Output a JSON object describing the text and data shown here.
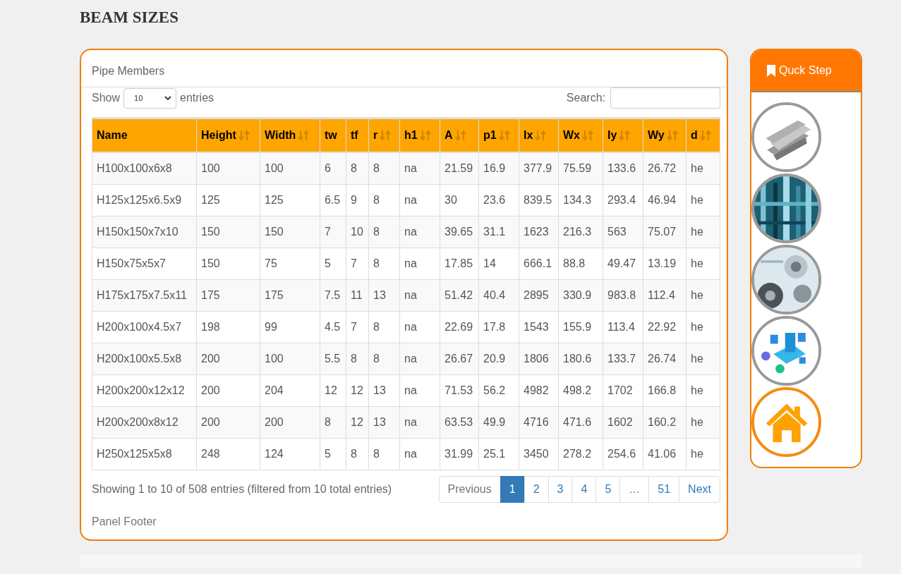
{
  "page_title": "BEAM SIZES",
  "panel": {
    "heading": "Pipe Members",
    "show_label": "Show",
    "page_size": "10",
    "entries_label": "entries",
    "search_label": "Search:",
    "table": {
      "columns": [
        {
          "label": "Name",
          "sortable": false
        },
        {
          "label": "Height",
          "sortable": true
        },
        {
          "label": "Width",
          "sortable": true
        },
        {
          "label": "tw",
          "sortable": false
        },
        {
          "label": "tf",
          "sortable": false
        },
        {
          "label": "r",
          "sortable": true
        },
        {
          "label": "h1",
          "sortable": true
        },
        {
          "label": "A",
          "sortable": true
        },
        {
          "label": "p1",
          "sortable": true
        },
        {
          "label": "Ix",
          "sortable": true
        },
        {
          "label": "Wx",
          "sortable": true
        },
        {
          "label": "Iy",
          "sortable": true
        },
        {
          "label": "Wy",
          "sortable": true
        },
        {
          "label": "d",
          "sortable": true
        }
      ],
      "rows": [
        [
          "H100x100x6x8",
          "100",
          "100",
          "6",
          "8",
          "8",
          "na",
          "21.59",
          "16.9",
          "377.9",
          "75.59",
          "133.6",
          "26.72",
          "he"
        ],
        [
          "H125x125x6.5x9",
          "125",
          "125",
          "6.5",
          "9",
          "8",
          "na",
          "30",
          "23.6",
          "839.5",
          "134.3",
          "293.4",
          "46.94",
          "he"
        ],
        [
          "H150x150x7x10",
          "150",
          "150",
          "7",
          "10",
          "8",
          "na",
          "39.65",
          "31.1",
          "1623",
          "216.3",
          "563",
          "75.07",
          "he"
        ],
        [
          "H150x75x5x7",
          "150",
          "75",
          "5",
          "7",
          "8",
          "na",
          "17.85",
          "14",
          "666.1",
          "88.8",
          "49.47",
          "13.19",
          "he"
        ],
        [
          "H175x175x7.5x11",
          "175",
          "175",
          "7.5",
          "11",
          "13",
          "na",
          "51.42",
          "40.4",
          "2895",
          "330.9",
          "983.8",
          "112.4",
          "he"
        ],
        [
          "H200x100x4.5x7",
          "198",
          "99",
          "4.5",
          "7",
          "8",
          "na",
          "22.69",
          "17.8",
          "1543",
          "155.9",
          "113.4",
          "22.92",
          "he"
        ],
        [
          "H200x100x5.5x8",
          "200",
          "100",
          "5.5",
          "8",
          "8",
          "na",
          "26.67",
          "20.9",
          "1806",
          "180.6",
          "133.7",
          "26.74",
          "he"
        ],
        [
          "H200x200x12x12",
          "200",
          "204",
          "12",
          "12",
          "13",
          "na",
          "71.53",
          "56.2",
          "4982",
          "498.2",
          "1702",
          "166.8",
          "he"
        ],
        [
          "H200x200x8x12",
          "200",
          "200",
          "8",
          "12",
          "13",
          "na",
          "63.53",
          "49.9",
          "4716",
          "471.6",
          "1602",
          "160.2",
          "he"
        ],
        [
          "H250x125x5x8",
          "248",
          "124",
          "5",
          "8",
          "8",
          "na",
          "31.99",
          "25.1",
          "3450",
          "278.2",
          "254.6",
          "41.06",
          "he"
        ]
      ]
    },
    "info": "Showing 1 to 10 of 508 entries (filtered from 10 total entries)",
    "pagination": [
      {
        "label": "Previous",
        "selected": false,
        "disabled": true
      },
      {
        "label": "1",
        "selected": true,
        "disabled": false
      },
      {
        "label": "2",
        "selected": false,
        "disabled": false
      },
      {
        "label": "3",
        "selected": false,
        "disabled": false
      },
      {
        "label": "4",
        "selected": false,
        "disabled": false
      },
      {
        "label": "5",
        "selected": false,
        "disabled": false
      },
      {
        "label": "…",
        "selected": false,
        "disabled": true
      },
      {
        "label": "51",
        "selected": false,
        "disabled": false
      },
      {
        "label": "Next",
        "selected": false,
        "disabled": false
      }
    ],
    "footer": "Panel Footer"
  },
  "sidebar": {
    "title": "Quck Step",
    "items": [
      {
        "kind": "picture"
      },
      {
        "kind": "picture"
      },
      {
        "kind": "picture"
      },
      {
        "kind": "picture"
      },
      {
        "kind": "home"
      }
    ]
  }
}
